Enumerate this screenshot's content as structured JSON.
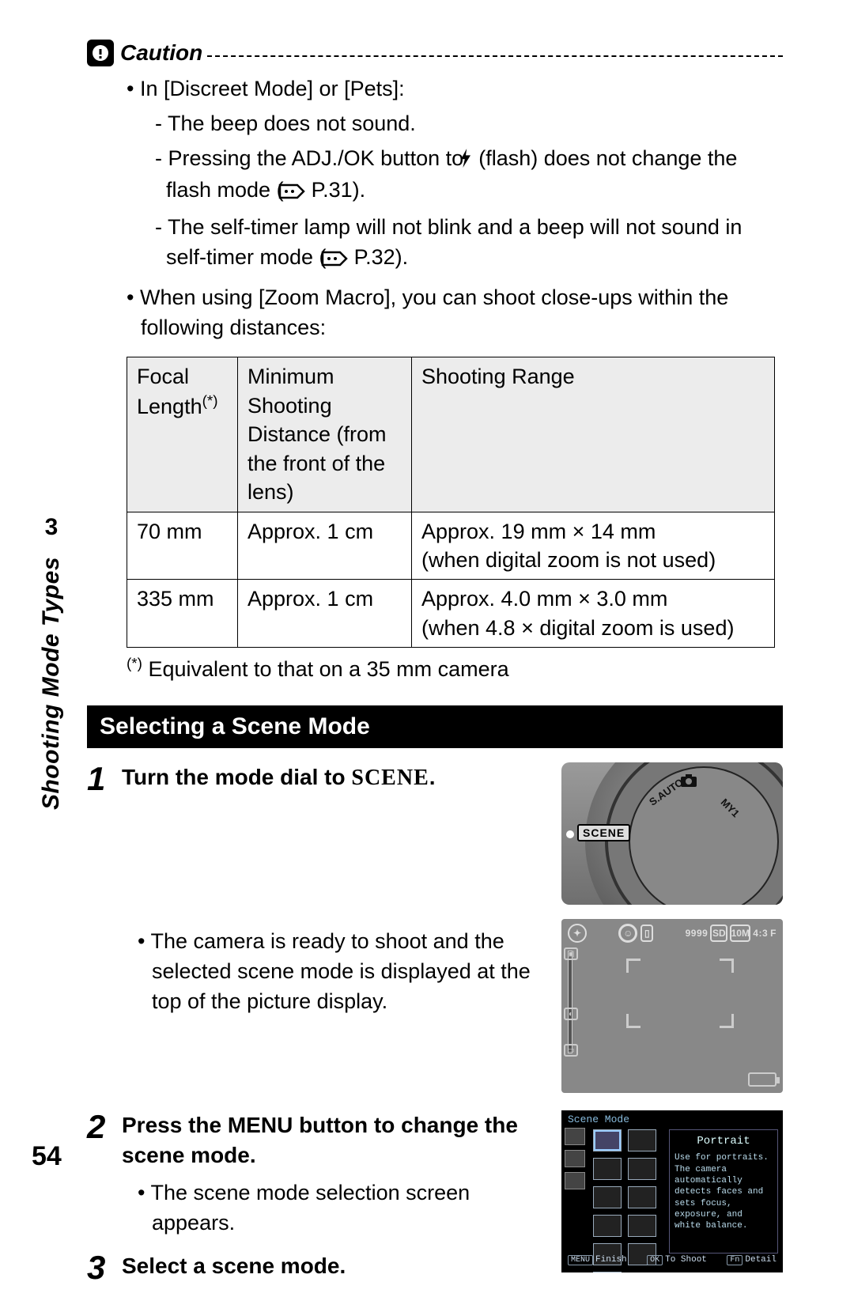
{
  "sidebar": {
    "chapter_number": "3",
    "chapter_title": "Shooting Mode Types"
  },
  "page_number": "54",
  "caution": {
    "label": "Caution",
    "item1_intro": "In [Discreet Mode] or [Pets]:",
    "item1_a": "The beep does not sound.",
    "item1_b_pre": "Pressing the ADJ./OK button to ",
    "item1_b_mid": " (flash) does not change the flash mode (",
    "item1_b_ref": "P.31",
    "item1_b_post": ").",
    "item1_c_pre": "The self-timer lamp will not blink and a beep will not sound in self-timer mode (",
    "item1_c_ref": "P.32",
    "item1_c_post": ").",
    "item2": "When using [Zoom Macro], you can shoot close-ups within the following distances:"
  },
  "table": {
    "headers": {
      "focal": "Focal Length",
      "focal_sup": "(*)",
      "min_dist": "Minimum Shooting Distance (from the front of the lens)",
      "range": "Shooting Range"
    },
    "rows": [
      {
        "focal": "70 mm",
        "min_dist": "Approx. 1 cm",
        "range": "Approx. 19 mm × 14 mm\n(when digital zoom is not used)"
      },
      {
        "focal": "335 mm",
        "min_dist": "Approx. 1 cm",
        "range": "Approx. 4.0 mm × 3.0 mm\n(when 4.8 × digital zoom is used)"
      }
    ],
    "footnote_sup": "(*)",
    "footnote": " Equivalent to that on a 35 mm camera"
  },
  "section_heading": "Selecting a Scene Mode",
  "steps": {
    "s1": {
      "num": "1",
      "title_pre": "Turn the mode dial to ",
      "title_mode": "SCENE",
      "title_post": ".",
      "bullet": "The camera is ready to shoot and the selected scene mode is displayed at the top of the picture display."
    },
    "s2": {
      "num": "2",
      "title": "Press the MENU button to change the scene mode.",
      "bullet": "The scene mode selection screen appears."
    },
    "s3": {
      "num": "3",
      "title": "Select a scene mode."
    }
  },
  "dial": {
    "scene_label": "SCENE",
    "label_sauto": "S.AUTO",
    "label_my1": "MY1"
  },
  "lcd": {
    "shots": "9999",
    "sd": "SD",
    "size": "10M",
    "ratio": "4:3",
    "quality": "F"
  },
  "menu": {
    "title": "Scene Mode",
    "mode_title": "Portrait",
    "mode_desc": "Use for portraits. The camera automatically detects faces and sets focus, exposure, and white balance.",
    "finish_key": "MENU",
    "finish": "Finish",
    "ok_key": "OK",
    "ok": "To Shoot",
    "fn_key": "Fn",
    "fn": "Detail"
  }
}
